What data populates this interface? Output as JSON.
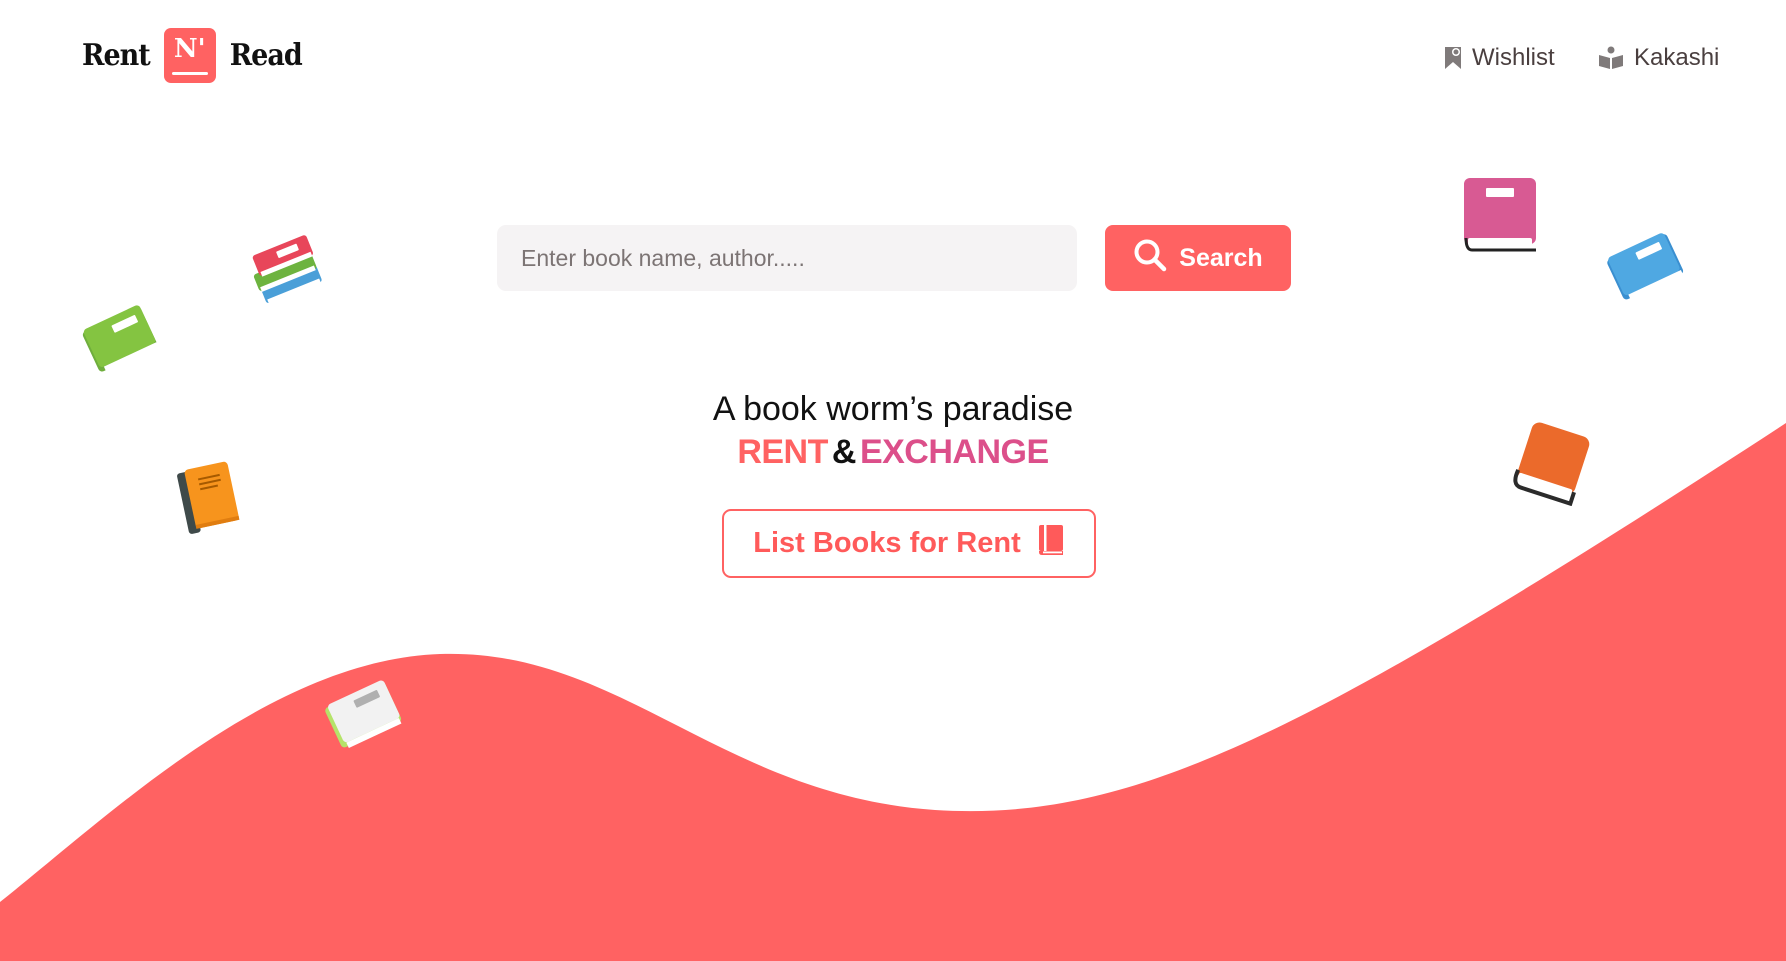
{
  "brand": {
    "word_left": "Rent",
    "mark": "N'",
    "word_right": "Read"
  },
  "nav": {
    "wishlist_label": "Wishlist",
    "user_label": "Kakashi"
  },
  "search": {
    "placeholder": "Enter book name, author.....",
    "value": "",
    "button_label": "Search"
  },
  "hero": {
    "tagline": "A book worm’s paradise",
    "headline_rent": "RENT",
    "headline_amp": "&",
    "headline_exchange": "EXCHANGE",
    "cta_label": "List Books for Rent"
  },
  "colors": {
    "accent": "#ff6262",
    "exchange": "#dc4f8a",
    "text": "#111111",
    "nav_text": "#4a3f3f",
    "input_bg": "#f5f3f4"
  },
  "icons": {
    "wishlist": "bookmark-icon",
    "user": "open-book-icon",
    "search": "magnifier-icon",
    "cta": "book-icon",
    "decor": [
      "green-book-icon",
      "books-stack-icon",
      "orange-book-icon",
      "light-green-book-icon",
      "pink-book-icon",
      "blue-book-icon",
      "orange-red-book-icon"
    ]
  }
}
